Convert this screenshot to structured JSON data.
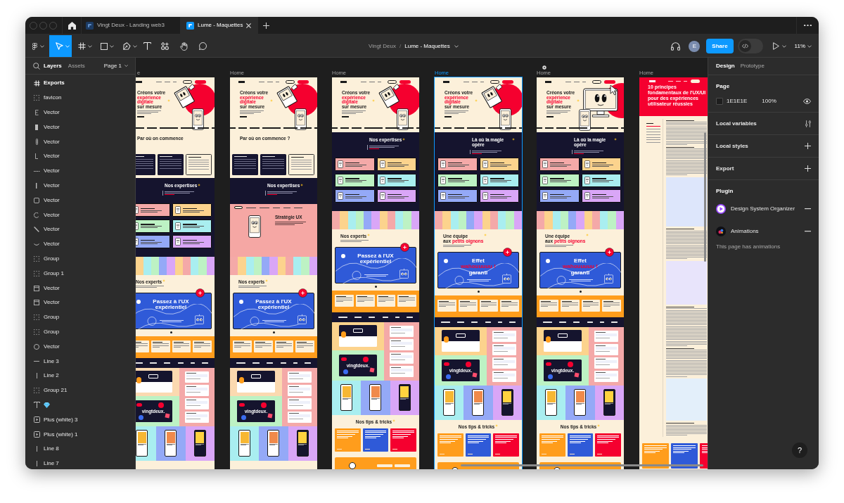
{
  "tabs": [
    {
      "title": "Vingt Deux - Landing web3",
      "selected": false
    },
    {
      "title": "Lume - Maquettes",
      "selected": true
    }
  ],
  "toolbar": {
    "tools": [
      {
        "kind": "main-menu",
        "selected": false,
        "menu": true
      },
      {
        "kind": "move",
        "selected": true,
        "menu": true
      },
      {
        "kind": "frame",
        "selected": false,
        "menu": true
      },
      {
        "kind": "shape",
        "selected": false,
        "menu": true
      },
      {
        "kind": "pen",
        "selected": false,
        "menu": true
      },
      {
        "kind": "text",
        "selected": false,
        "menu": false
      },
      {
        "kind": "resources",
        "selected": false,
        "menu": false
      },
      {
        "kind": "hand",
        "selected": false,
        "menu": false
      },
      {
        "kind": "comment",
        "selected": false,
        "menu": false
      }
    ],
    "breadcrumb": {
      "team": "Vingt Deux",
      "separator": "/",
      "file": "Lume - Maquettes"
    },
    "avatar": "E",
    "share": "Share",
    "dev_mode": {
      "on": false
    },
    "zoom": "11%"
  },
  "layers_panel": {
    "tabs": [
      {
        "label": "Layers",
        "selected": true
      },
      {
        "label": "Assets",
        "selected": false
      }
    ],
    "page": "Page 1",
    "layers": [
      {
        "name": "Exports",
        "kind": "frame"
      },
      {
        "name": "favicon",
        "kind": "group"
      },
      {
        "name": "Vector",
        "kind": "vector"
      },
      {
        "name": "Vector",
        "kind": "vector"
      },
      {
        "name": "Vector",
        "kind": "vector"
      },
      {
        "name": "Vector",
        "kind": "vector"
      },
      {
        "name": "Vector",
        "kind": "vector"
      },
      {
        "name": "Vector",
        "kind": "vector"
      },
      {
        "name": "Vector",
        "kind": "vector"
      },
      {
        "name": "Vector",
        "kind": "vector"
      },
      {
        "name": "Vector",
        "kind": "vector"
      },
      {
        "name": "Vector",
        "kind": "vector"
      },
      {
        "name": "Group",
        "kind": "group"
      },
      {
        "name": "Group 1",
        "kind": "group"
      },
      {
        "name": "Vector",
        "kind": "vector"
      },
      {
        "name": "Vector",
        "kind": "vector"
      },
      {
        "name": "Group",
        "kind": "group"
      },
      {
        "name": "Group",
        "kind": "group"
      },
      {
        "name": "Vector",
        "kind": "vector"
      },
      {
        "name": "Line 3",
        "kind": "line"
      },
      {
        "name": "Line 2",
        "kind": "line"
      },
      {
        "name": "Group 21",
        "kind": "group"
      },
      {
        "kind": "text"
      },
      {
        "name": "Plus (white) 3",
        "kind": "media"
      },
      {
        "name": "Plus (white) 1",
        "kind": "media"
      },
      {
        "name": "Line 8",
        "kind": "line"
      },
      {
        "name": "Line 7",
        "kind": "line"
      }
    ]
  },
  "canvas": {
    "frames": [
      {
        "label": "e",
        "selected": false,
        "sections": [
          {
            "kind": "hero",
            "art": {
              "kind": "phone"
            },
            "heading": [
              [
                {
                  "text": "Créons votre",
                  "accent": false
                }
              ],
              [
                {
                  "text": "expérience",
                  "accent": true
                }
              ],
              [
                {
                  "text": "digitale",
                  "accent": true
                }
              ],
              [
                {
                  "text": "sur mesure",
                  "accent": false
                }
              ]
            ]
          },
          {
            "kind": "steps",
            "heading": "Par où on commence"
          },
          {
            "kind": "expertises",
            "heading": "Nos expertises"
          },
          {
            "kind": "team"
          },
          {
            "kind": "experts",
            "heading": [
              [
                {
                  "text": "Nos experts",
                  "accent": false
                }
              ]
            ],
            "card": [
              [
                {
                  "text": "Passez à l'UX",
                  "accent": false
                }
              ],
              [
                {
                  "text": "expérientiel",
                  "accent": false
                }
              ]
            ]
          },
          {
            "kind": "offer"
          },
          {
            "kind": "logos"
          },
          {
            "kind": "portfolio",
            "brand": "vingtdeux.",
            "tiles": [
              {
                "color": "#fbd9b0"
              },
              {
                "color": "#f4a9a8"
              },
              {
                "color": "#bdf2c4"
              },
              {
                "color": "#a9eef0"
              },
              {
                "color": "#94a9f7"
              },
              {
                "color": "#d9a6f7"
              }
            ]
          }
        ]
      },
      {
        "label": "Home",
        "selected": false,
        "sections": [
          {
            "kind": "hero",
            "art": {
              "kind": "phone"
            },
            "heading": [
              [
                {
                  "text": "Créons votre",
                  "accent": false
                }
              ],
              [
                {
                  "text": "expérience",
                  "accent": true
                }
              ],
              [
                {
                  "text": "digitale",
                  "accent": true
                }
              ],
              [
                {
                  "text": "sur mesure",
                  "accent": false
                }
              ]
            ]
          },
          {
            "kind": "steps",
            "heading": "Par où on commence ?"
          },
          {
            "kind": "intro",
            "heading": "Nos expertises"
          },
          {
            "kind": "strategy",
            "heading": "Stratégie UX"
          },
          {
            "kind": "team"
          },
          {
            "kind": "experts",
            "heading": [
              [
                {
                  "text": "Nos experts",
                  "accent": false
                }
              ]
            ],
            "card": [
              [
                {
                  "text": "Passez à l'UX",
                  "accent": false
                }
              ],
              [
                {
                  "text": "expérientiel",
                  "accent": false
                }
              ]
            ]
          },
          {
            "kind": "offer"
          },
          {
            "kind": "logos"
          },
          {
            "kind": "portfolio",
            "brand": "vingtdeux.",
            "tiles": [
              {
                "color": "#fbd9b0"
              },
              {
                "color": "#f4a9a8"
              },
              {
                "color": "#bdf2c4"
              },
              {
                "color": "#a9eef0"
              },
              {
                "color": "#94a9f7"
              },
              {
                "color": "#d9a6f7"
              }
            ]
          }
        ]
      },
      {
        "label": "Home",
        "selected": false,
        "sections": [
          {
            "kind": "hero",
            "art": {
              "kind": "phone"
            },
            "heading": [
              [
                {
                  "text": "Créons votre",
                  "accent": false
                }
              ],
              [
                {
                  "text": "expérience",
                  "accent": true
                }
              ],
              [
                {
                  "text": "digitale",
                  "accent": true
                }
              ],
              [
                {
                  "text": "sur mesure",
                  "accent": false
                }
              ]
            ]
          },
          {
            "kind": "expertises",
            "heading": "Nos expertises"
          },
          {
            "kind": "team"
          },
          {
            "kind": "experts",
            "heading": [
              [
                {
                  "text": "Nos experts",
                  "accent": false
                }
              ]
            ],
            "card": [
              [
                {
                  "text": "Passez à l'UX",
                  "accent": false
                }
              ],
              [
                {
                  "text": "expérientiel",
                  "accent": false
                }
              ]
            ]
          },
          {
            "kind": "offer"
          },
          {
            "kind": "logos"
          },
          {
            "kind": "portfolio",
            "brand": "vingtdeux.",
            "tiles": [
              {
                "color": "#fcd38d"
              },
              {
                "color": "#f4a9a8"
              },
              {
                "color": "#bdf2c4"
              },
              {
                "color": "#a9eef0"
              },
              {
                "color": "#94a9f7"
              },
              {
                "color": "#d9a6f7"
              }
            ]
          },
          {
            "kind": "tips",
            "heading": "Nos tips & tricks",
            "cards": [
              {
                "color": "#ff9d1c"
              },
              {
                "color": "#2f5ad8"
              },
              {
                "color": "#f5002f"
              }
            ]
          },
          {
            "kind": "contact"
          }
        ]
      },
      {
        "label": "Home",
        "selected": true,
        "sections": [
          {
            "kind": "hero",
            "art": {
              "kind": "phone"
            },
            "heading": [
              [
                {
                  "text": "Créons votre",
                  "accent": false
                }
              ],
              [
                {
                  "text": "expérience",
                  "accent": true
                }
              ],
              [
                {
                  "text": "digitale",
                  "accent": true
                }
              ],
              [
                {
                  "text": "sur mesure",
                  "accent": false
                }
              ]
            ]
          },
          {
            "kind": "expertises",
            "heading": "Là où la magie opère"
          },
          {
            "kind": "team"
          },
          {
            "kind": "experts",
            "heading": [
              [
                {
                  "text": "Une équipe",
                  "accent": false
                }
              ],
              [
                {
                  "text": "aux ",
                  "accent": false
                },
                {
                  "text": "petits oignons",
                  "accent": true
                }
              ]
            ],
            "card": [
              [
                {
                  "text": "Effet",
                  "accent": false
                }
              ],
              [
                {
                  "text": "wahouuuuu !",
                  "accent": true
                }
              ],
              [
                {
                  "text": "garanti",
                  "accent": false
                }
              ]
            ]
          },
          {
            "kind": "offer"
          },
          {
            "kind": "logos"
          },
          {
            "kind": "portfolio",
            "brand": "vingtdeux.",
            "tiles": [
              {
                "color": "#fcd38d"
              },
              {
                "color": "#f4a9a8"
              },
              {
                "color": "#bdf2c4"
              },
              {
                "color": "#a9eef0"
              },
              {
                "color": "#94a9f7"
              },
              {
                "color": "#d9a6f7"
              }
            ]
          },
          {
            "kind": "tips",
            "heading": "Nos tips & tricks",
            "cards": [
              {
                "color": "#ff9d1c"
              },
              {
                "color": "#2f5ad8"
              },
              {
                "color": "#f5002f"
              }
            ]
          },
          {
            "kind": "contact"
          }
        ]
      },
      {
        "label": "Home",
        "selected": false,
        "sections": [
          {
            "kind": "hero",
            "art": {
              "kind": "monitor"
            },
            "heading": [
              [
                {
                  "text": "Créons votre",
                  "accent": false
                }
              ],
              [
                {
                  "text": "expérience",
                  "accent": true
                }
              ],
              [
                {
                  "text": "digitale",
                  "accent": true
                }
              ],
              [
                {
                  "text": "sur mesure",
                  "accent": false
                }
              ]
            ]
          },
          {
            "kind": "expertises",
            "heading": "Là où la magie opère"
          },
          {
            "kind": "team"
          },
          {
            "kind": "experts",
            "heading": [
              [
                {
                  "text": "Une équipe",
                  "accent": false
                }
              ],
              [
                {
                  "text": "aux ",
                  "accent": false
                },
                {
                  "text": "petits oignons",
                  "accent": true
                }
              ]
            ],
            "card": [
              [
                {
                  "text": "Effet",
                  "accent": false
                }
              ],
              [
                {
                  "text": "wahouuuuu !",
                  "accent": true
                }
              ],
              [
                {
                  "text": "garanti",
                  "accent": false
                }
              ]
            ]
          },
          {
            "kind": "offer"
          },
          {
            "kind": "logos"
          },
          {
            "kind": "portfolio",
            "brand": "vingtdeux.",
            "tiles": [
              {
                "color": "#fcd38d"
              },
              {
                "color": "#f4a9a8"
              },
              {
                "color": "#bdf2c4"
              },
              {
                "color": "#a9eef0"
              },
              {
                "color": "#94a9f7"
              },
              {
                "color": "#d9a6f7"
              }
            ]
          },
          {
            "kind": "tips",
            "heading": "Nos tips & tricks",
            "cards": [
              {
                "color": "#ff9d1c"
              },
              {
                "color": "#2f5ad8"
              },
              {
                "color": "#f5002f"
              }
            ]
          },
          {
            "kind": "contact"
          }
        ]
      },
      {
        "label": "Home",
        "selected": false,
        "sections": [
          {
            "kind": "article-hero",
            "title": "10 principes fondamentaux de l'UX/UI pour des expériences utilisateur réussies"
          },
          {
            "kind": "article-body"
          },
          {
            "kind": "related",
            "cards": [
              {
                "color": "#ff9d1c"
              },
              {
                "color": "#2f5ad8"
              },
              {
                "color": "#f5002f"
              }
            ]
          }
        ]
      }
    ]
  },
  "design_panel": {
    "tabs": [
      {
        "label": "Design",
        "selected": true
      },
      {
        "label": "Prototype",
        "selected": false
      }
    ],
    "page": {
      "title": "Page",
      "fill": "1E1E1E",
      "opacity": "100%",
      "visible": true
    },
    "rows": [
      {
        "title": "Local variables",
        "kind": "adjust"
      },
      {
        "title": "Local styles",
        "kind": "add"
      },
      {
        "title": "Export",
        "kind": "add"
      }
    ],
    "plugin": {
      "title": "Plugin",
      "items": [
        {
          "name": "Design System Organizer",
          "kind": "organizer"
        },
        {
          "name": "Animations",
          "kind": "animation"
        }
      ],
      "note": "This page has animations"
    }
  },
  "help": "?"
}
